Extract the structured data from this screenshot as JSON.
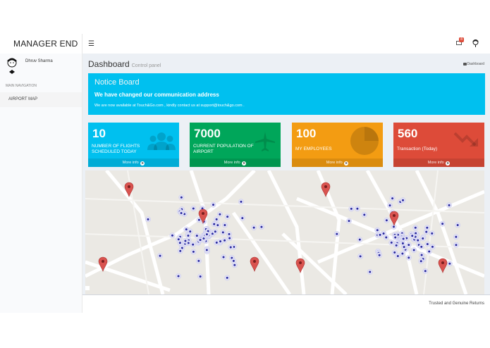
{
  "brand": "MANAGER END",
  "header": {
    "notifications_count": "8"
  },
  "user": {
    "name": "Dhruv Sharma"
  },
  "sidebar": {
    "header": "MAIN NAVIGATION",
    "items": [
      {
        "label": "AIRPORT MAP"
      }
    ]
  },
  "page": {
    "title": "Dashboard",
    "subtitle": "Control panel",
    "breadcrumb": "Dashboard"
  },
  "notice": {
    "title": "Notice Board",
    "headline": "We have changed our communication address",
    "text": "We are now available at Touch&Go.com , kindly contact us at support@touch&go.com ."
  },
  "stats": [
    {
      "value": "10",
      "label_line1": "NUMBER OF FLIGHTS",
      "label_line2": "SCHEDULED TODAY",
      "footer": "More info",
      "color": "#00c0ef",
      "icon": "users-icon"
    },
    {
      "value": "7000",
      "label_line1": "CURRENT POPULATION OF",
      "label_line2": "AIRPORT",
      "footer": "More info",
      "color": "#00a65a",
      "icon": "airplane-icon"
    },
    {
      "value": "100",
      "label_line1": "MY EMPLOYEES",
      "label_line2": "",
      "footer": "More info",
      "color": "#f39c12",
      "icon": "pie-chart-icon"
    },
    {
      "value": "560",
      "label_line1": "Transaction (Today)",
      "label_line2": "",
      "footer": "More info",
      "color": "#dd4b39",
      "icon": "trend-down-icon"
    }
  ],
  "footer": {
    "text": "Trusted and Genuine Returns"
  },
  "colors": {
    "aqua": "#00c0ef",
    "green": "#00a65a",
    "yellow": "#f39c12",
    "red": "#dd4b39",
    "marker": "#d9534f",
    "point": "#2a2aa0"
  }
}
